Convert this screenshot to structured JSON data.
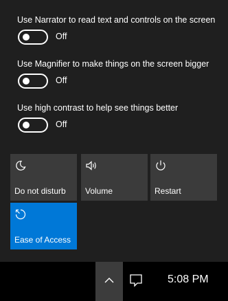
{
  "accessibility": {
    "narrator": {
      "label": "Use Narrator to read text and controls on the screen",
      "state": "Off"
    },
    "magnifier": {
      "label": "Use Magnifier to make things on the screen bigger",
      "state": "Off"
    },
    "high_contrast": {
      "label": "Use high contrast to help see things better",
      "state": "Off"
    }
  },
  "quick_actions": [
    {
      "label": "Do not disturb",
      "icon": "moon-icon",
      "active": false
    },
    {
      "label": "Volume",
      "icon": "speaker-icon",
      "active": false
    },
    {
      "label": "Restart",
      "icon": "power-icon",
      "active": false
    },
    {
      "label": "Ease of Access",
      "icon": "ease-of-access-icon",
      "active": true
    }
  ],
  "taskbar": {
    "time": "5:08 PM",
    "chevron_icon": "chevron-up-icon",
    "notification_icon": "action-center-icon"
  },
  "colors": {
    "panel_bg": "#1f1f1f",
    "tile_bg": "#3b3b3b",
    "accent": "#0078d7",
    "taskbar_bg": "#000000"
  }
}
